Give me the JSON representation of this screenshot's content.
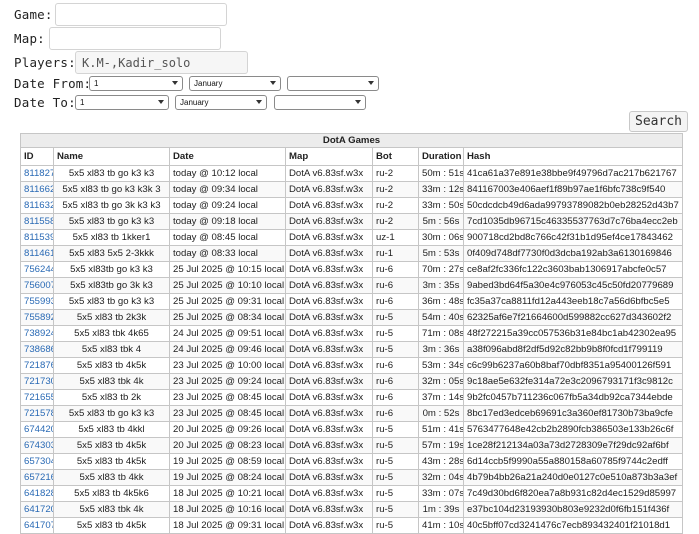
{
  "form": {
    "game_label": "Game:",
    "map_label": "Map:",
    "players_label": "Players:",
    "players_value": "K.M-,Kadir_solo",
    "date_from_label": "Date From:",
    "date_to_label": "Date To:",
    "from_day": "1",
    "from_month": "January",
    "from_year": "",
    "to_day": "1",
    "to_month": "January",
    "to_year": "",
    "search_label": "Search"
  },
  "table": {
    "caption": "DotA Games",
    "columns": [
      "ID",
      "Name",
      "Date",
      "Map",
      "Bot",
      "Duration",
      "Hash"
    ],
    "rows": [
      [
        "811827",
        "5x5 xl83 tb go k3 k3",
        "today @ 10:12 local",
        "DotA v6.83sf.w3x",
        "ru-2",
        "50m : 51s",
        "41ca61a37e891e38bbe9f49796d7ac217b621767"
      ],
      [
        "811662",
        "5x5 xl83 tb go k3 k3k 3",
        "today @ 09:34 local",
        "DotA v6.83sf.w3x",
        "ru-2",
        "33m : 12s",
        "841167003e406aef1f89b97ae1f6bfc738c9f540"
      ],
      [
        "811632",
        "5x5 xl83 tb go 3k k3 k3",
        "today @ 09:24 local",
        "DotA v6.83sf.w3x",
        "ru-2",
        "33m : 50s",
        "50cdcdcb49d6ada99793789082b0eb28252d43b7"
      ],
      [
        "811558",
        "5x5 xl83 tb go k3 k3",
        "today @ 09:18 local",
        "DotA v6.83sf.w3x",
        "ru-2",
        "5m : 56s",
        "7cd1035db96715c46335537763d7c76ba4ecc2eb"
      ],
      [
        "811539",
        "5x5 xl83 tb 1kker1",
        "today @ 08:45 local",
        "DotA v6.83sf.w3x",
        "uz-1",
        "30m : 06s",
        "900718cd2bd8c766c42f31b1d95ef4ce17843462"
      ],
      [
        "811461",
        "5x5 xl83 5x5 2-3kkk",
        "today @ 08:33 local",
        "DotA v6.83sf.w3x",
        "ru-1",
        "5m : 53s",
        "0f409d748df7730f0d3dcba192ab3a6130169846"
      ],
      [
        "756244",
        "5x5 xl83tb go k3 k3",
        "25 Jul 2025 @ 10:15 local",
        "DotA v6.83sf.w3x",
        "ru-6",
        "70m : 27s",
        "ce8af2fc336fc122c3603bab1306917abcfe0c57"
      ],
      [
        "756007",
        "5x5 xl83tb go 3k k3",
        "25 Jul 2025 @ 10:10 local",
        "DotA v6.83sf.w3x",
        "ru-6",
        "3m : 35s",
        "9abed3bd64f5a30e4c976053c45c50fd20779689"
      ],
      [
        "755993",
        "5x5 xl83 tb go k3 k3",
        "25 Jul 2025 @ 09:31 local",
        "DotA v6.83sf.w3x",
        "ru-6",
        "36m : 48s",
        "fc35a37ca8811fd12a443eeb18c7a56d6bfbc5e5"
      ],
      [
        "755892",
        "5x5 xl83 tb 2k3k",
        "25 Jul 2025 @ 08:34 local",
        "DotA v6.83sf.w3x",
        "ru-5",
        "54m : 40s",
        "62325af6e7f21664600d599882cc627d343602f2"
      ],
      [
        "738924",
        "5x5 xl83 tbk 4k65",
        "24 Jul 2025 @ 09:51 local",
        "DotA v6.83sf.w3x",
        "ru-5",
        "71m : 08s",
        "48f272215a39cc057536b31e84bc1ab42302ea95"
      ],
      [
        "738686",
        "5x5 xl83 tbk 4",
        "24 Jul 2025 @ 09:46 local",
        "DotA v6.83sf.w3x",
        "ru-5",
        "3m : 36s",
        "a38f096abd8f2df5d92c82bb9b8f0fcd1f799119"
      ],
      [
        "721876",
        "5x5 xl83 tb 4k5k",
        "23 Jul 2025 @ 10:00 local",
        "DotA v6.83sf.w3x",
        "ru-6",
        "53m : 34s",
        "c6c99b6237a60b8baf70dbf8351a95400126f591"
      ],
      [
        "721730",
        "5x5 xl83 tbk 4k",
        "23 Jul 2025 @ 09:24 local",
        "DotA v6.83sf.w3x",
        "ru-6",
        "32m : 05s",
        "9c18ae5e632fe314a72e3c2096793171f3c9812c"
      ],
      [
        "721655",
        "5x5 xl83 tb 2k",
        "23 Jul 2025 @ 08:45 local",
        "DotA v6.83sf.w3x",
        "ru-6",
        "37m : 14s",
        "9b2fc0457b711236c067fb5a34db92ca7344ebde"
      ],
      [
        "721578",
        "5x5 xl83 tb go k3 k3",
        "23 Jul 2025 @ 08:45 local",
        "DotA v6.83sf.w3x",
        "ru-6",
        "0m : 52s",
        "8bc17ed3edceb69691c3a360ef81730b73ba9cfe"
      ],
      [
        "674420",
        "5x5 xl83 tb 4kkl",
        "20 Jul 2025 @ 09:26 local",
        "DotA v6.83sf.w3x",
        "ru-5",
        "51m : 41s",
        "5763477648e42cb2b2890fcb386503e133b26c6f"
      ],
      [
        "674303",
        "5x5 xl83 tb 4k5k",
        "20 Jul 2025 @ 08:23 local",
        "DotA v6.83sf.w3x",
        "ru-5",
        "57m : 19s",
        "1ce28f212134a03a73d2728309e7f29dc92af6bf"
      ],
      [
        "657304",
        "5x5 xl83 tb 4k5k",
        "19 Jul 2025 @ 08:59 local",
        "DotA v6.83sf.w3x",
        "ru-5",
        "43m : 28s",
        "6d14ccb5f9990a55a880158a60785f9744c2edff"
      ],
      [
        "657216",
        "5x5 xl83 tb 4kk",
        "19 Jul 2025 @ 08:24 local",
        "DotA v6.83sf.w3x",
        "ru-5",
        "32m : 04s",
        "4b79b4bb26a21a240d0e0127c0e510a873b3a3ef"
      ],
      [
        "641828",
        "5x5 xl83 tb 4k5k6",
        "18 Jul 2025 @ 10:21 local",
        "DotA v6.83sf.w3x",
        "ru-5",
        "33m : 07s",
        "7c49d30bd6f820ea7a8b931c82d4ec1529d85997"
      ],
      [
        "641720",
        "5x5 xl83 tbk 4k",
        "18 Jul 2025 @ 10:16 local",
        "DotA v6.83sf.w3x",
        "ru-5",
        "1m : 39s",
        "e37bc104d23193930b803e9232d0f6fb151f436f"
      ],
      [
        "641707",
        "5x5 xl83 tb 4k5k",
        "18 Jul 2025 @ 09:31 local",
        "DotA v6.83sf.w3x",
        "ru-5",
        "41m : 10s",
        "40c5bff07cd3241476c7ecb893432401f21018d1"
      ]
    ]
  }
}
